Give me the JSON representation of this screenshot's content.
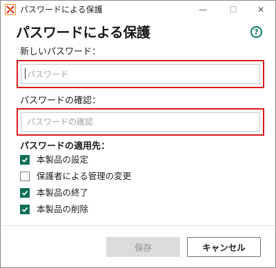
{
  "window": {
    "title": "パスワードによる保護",
    "min_glyph": "—",
    "max_glyph": "☐",
    "close_glyph": "✕"
  },
  "dialog": {
    "heading": "パスワードによる保護",
    "help_glyph": "?"
  },
  "new_password": {
    "label": "新しいパスワード：",
    "placeholder": "パスワード",
    "value": ""
  },
  "confirm_password": {
    "label": "パスワードの確認：",
    "placeholder": "パスワードの確認",
    "value": ""
  },
  "scope": {
    "label": "パスワードの適用先：",
    "options": [
      {
        "label": "本製品の設定",
        "checked": true
      },
      {
        "label": "保護者による管理の変更",
        "checked": false
      },
      {
        "label": "本製品の終了",
        "checked": true
      },
      {
        "label": "本製品の削除",
        "checked": true
      }
    ]
  },
  "buttons": {
    "save": "保存",
    "cancel": "キャンセル"
  },
  "colors": {
    "accent": "#0e6f58",
    "highlight_border": "#d9191c",
    "disabled_button": "#dcdcdc"
  }
}
